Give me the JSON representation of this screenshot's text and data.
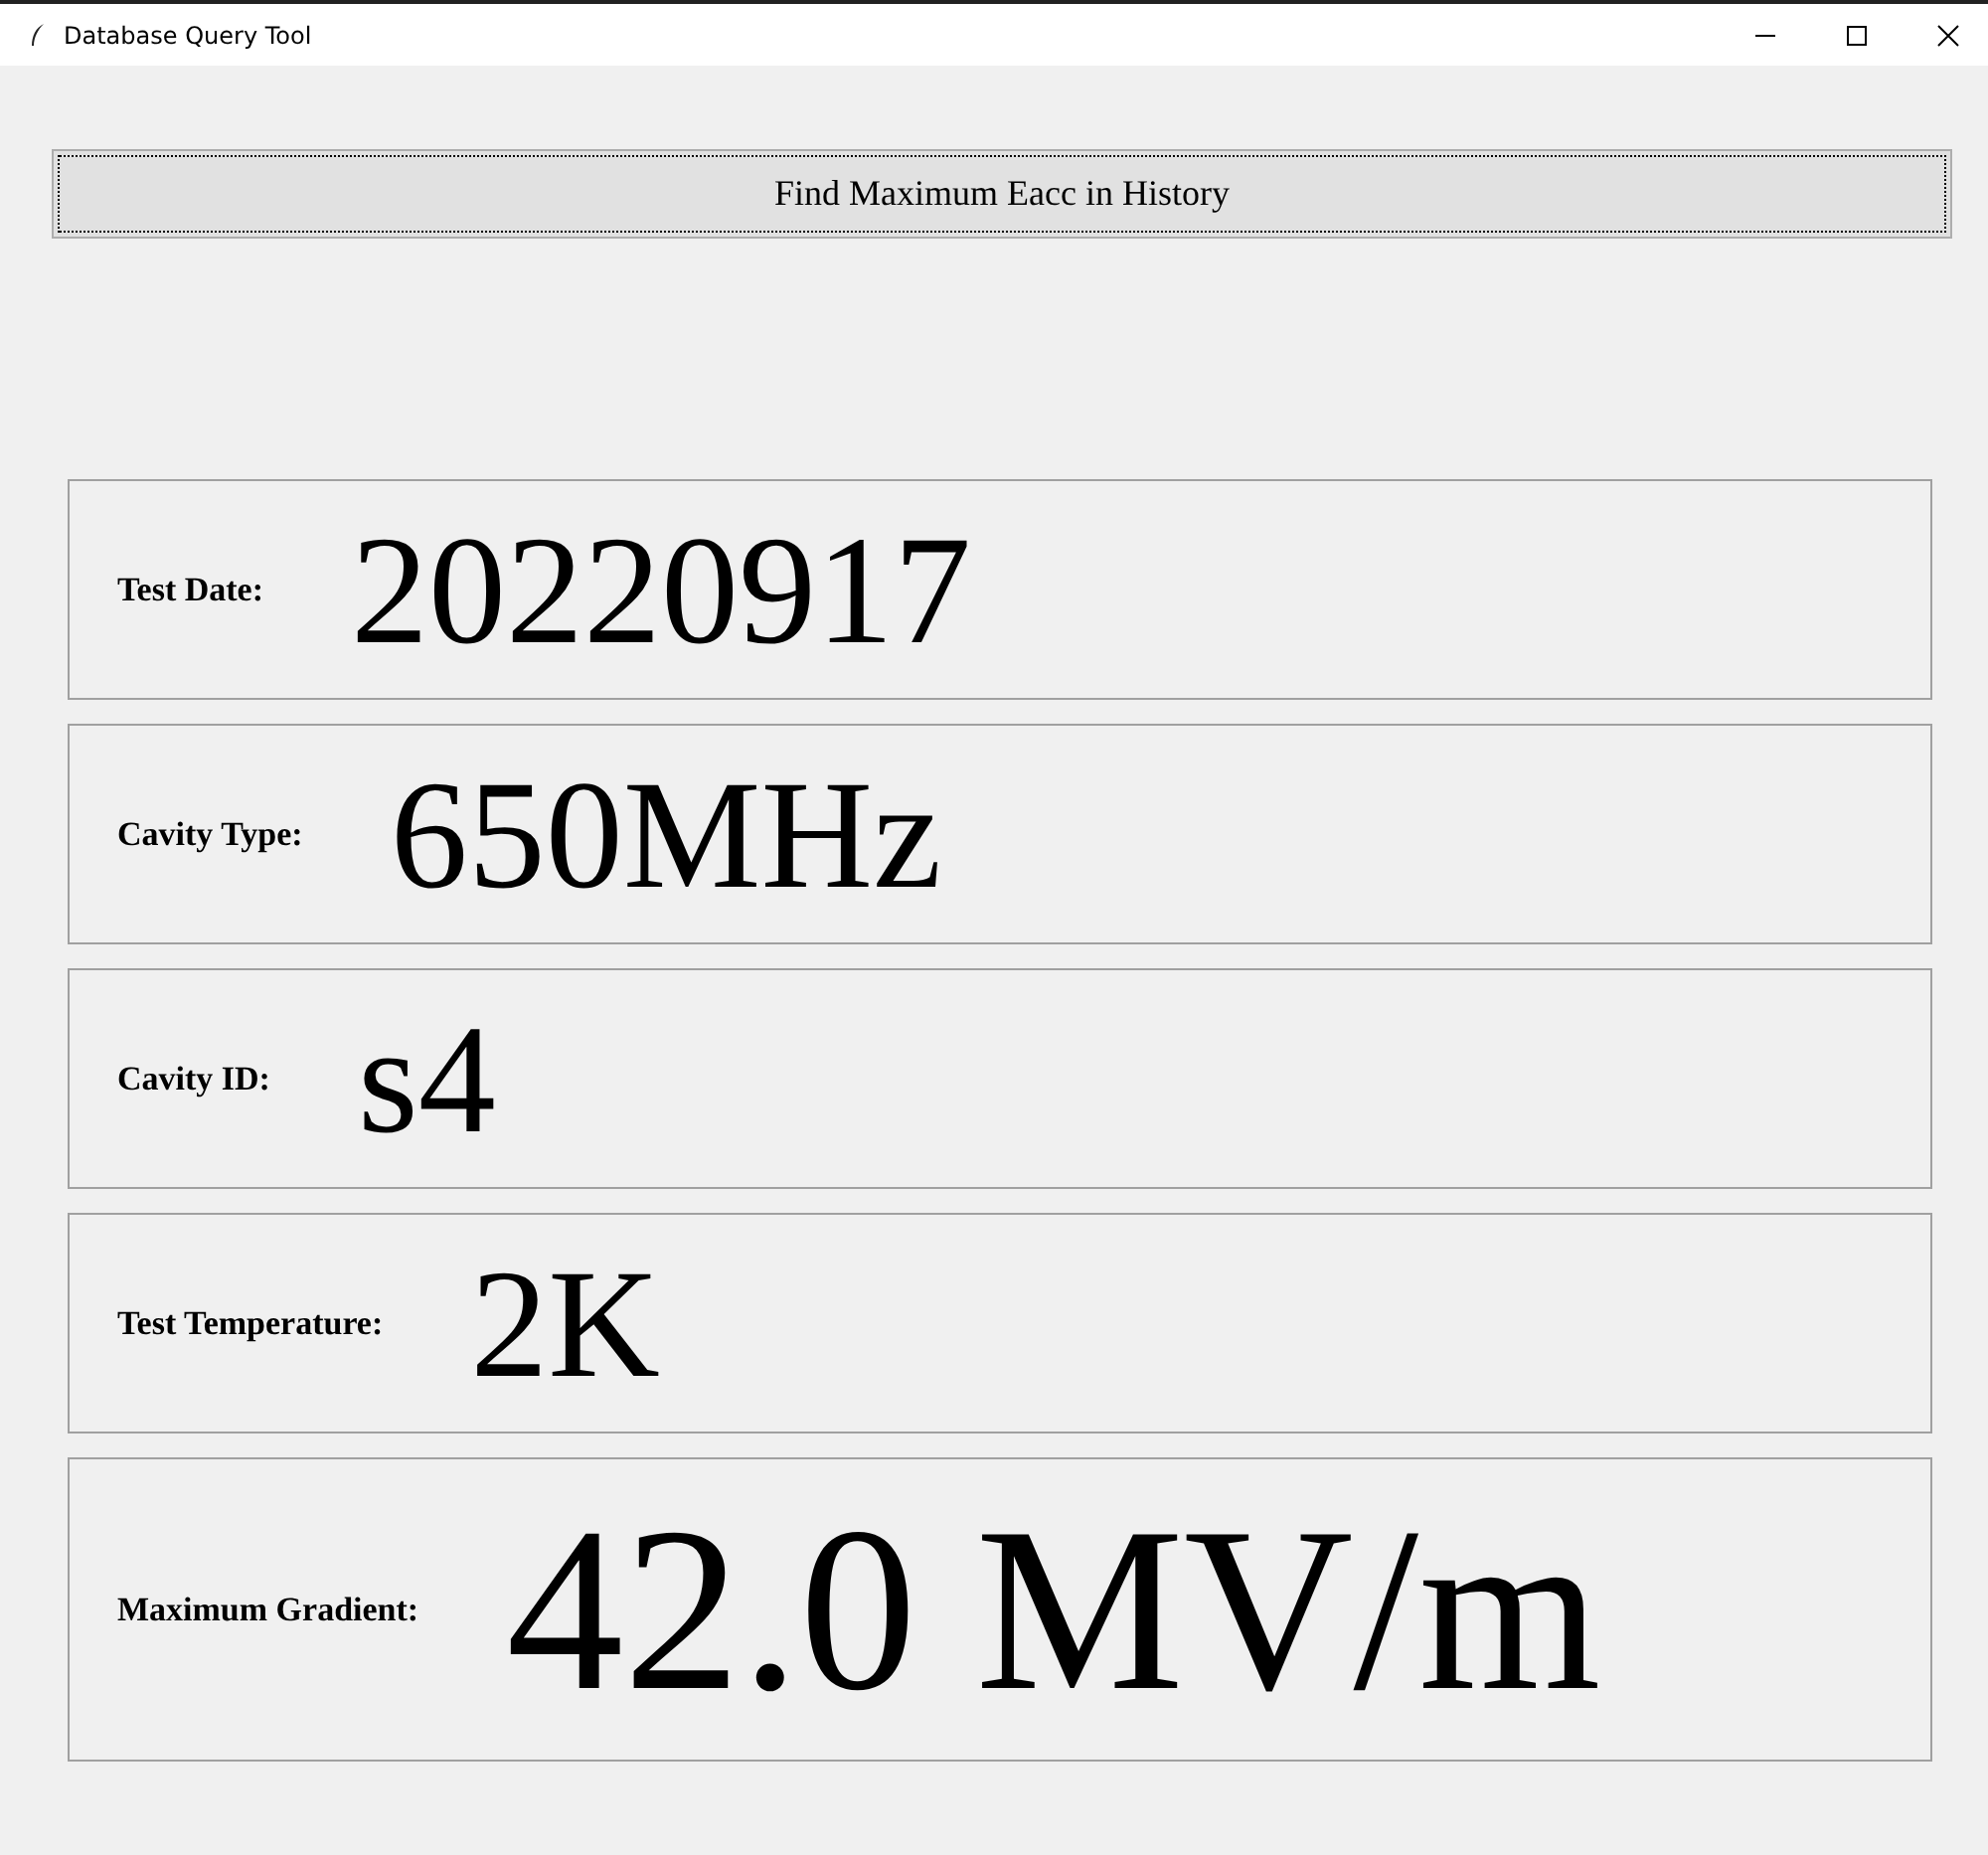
{
  "window": {
    "title": "Database Query Tool"
  },
  "query_button": {
    "label": "Find Maximum Eacc in History"
  },
  "results": [
    {
      "kind": "field",
      "label": "Test Date:",
      "value": "20220917"
    },
    {
      "kind": "field",
      "label": "Cavity Type:",
      "value": "650MHz"
    },
    {
      "kind": "field",
      "label": "Cavity ID:",
      "value": "s4"
    },
    {
      "kind": "field",
      "label": "Test Temperature:",
      "value": "2K"
    },
    {
      "kind": "result",
      "label": "Maximum Gradient:",
      "value": "42.0 MV/m"
    }
  ]
}
